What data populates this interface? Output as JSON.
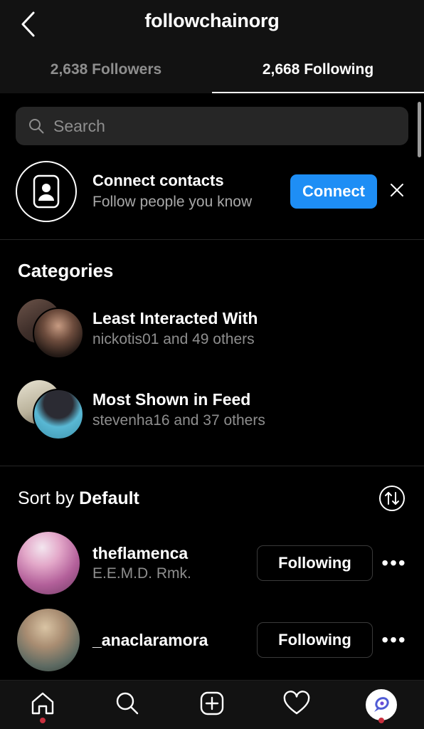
{
  "header": {
    "title": "followchainorg",
    "back_icon": "chevron-left-icon",
    "tabs": [
      {
        "label": "2,638 Followers",
        "active": false
      },
      {
        "label": "2,668 Following",
        "active": true
      }
    ]
  },
  "search": {
    "placeholder": "Search",
    "value": "",
    "icon": "search-icon"
  },
  "connect_contacts": {
    "icon": "contact-card-icon",
    "title": "Connect contacts",
    "subtitle": "Follow people you know",
    "button_label": "Connect",
    "button_color": "#1e8ef5",
    "close_icon": "close-icon"
  },
  "categories": {
    "heading": "Categories",
    "items": [
      {
        "title": "Least Interacted With",
        "subtitle": "nickotis01 and 49 others",
        "avatar_back": "#5d4a42",
        "avatar_front": "#3b2d28"
      },
      {
        "title": "Most Shown in Feed",
        "subtitle": "stevenha16 and 37 others",
        "avatar_back": "#cfc9b4",
        "avatar_front": "#4aa7c4"
      }
    ]
  },
  "sort": {
    "prefix": "Sort by ",
    "value": "Default",
    "icon": "sort-arrows-icon"
  },
  "following_list": [
    {
      "username": "theflamenca",
      "subtitle": "E.E.M.D. Rmk.",
      "button_label": "Following",
      "menu_icon": "more-options-icon",
      "avatar_color": "#c98bb0"
    },
    {
      "username": "_anaclaramora",
      "subtitle": "",
      "button_label": "Following",
      "menu_icon": "more-options-icon",
      "avatar_color": "#8b7f72"
    }
  ],
  "bottom_nav": [
    {
      "name": "home-icon",
      "badge": true
    },
    {
      "name": "search-icon",
      "badge": false
    },
    {
      "name": "create-post-icon",
      "badge": false
    },
    {
      "name": "heart-icon",
      "badge": false
    },
    {
      "name": "profile-avatar",
      "badge": true
    }
  ]
}
